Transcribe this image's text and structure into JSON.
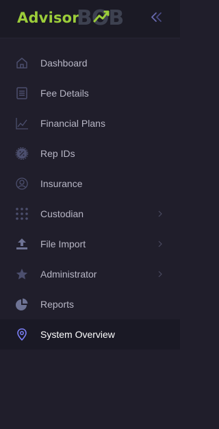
{
  "brand": {
    "text": "Advisor",
    "mark_text": "BOB",
    "accent_color": "#9ccd3a"
  },
  "nav": {
    "items": [
      {
        "label": "Dashboard",
        "icon": "home-icon"
      },
      {
        "label": "Fee Details",
        "icon": "receipt-icon"
      },
      {
        "label": "Financial Plans",
        "icon": "chart-line-icon"
      },
      {
        "label": "Rep IDs",
        "icon": "badge-percent-icon"
      },
      {
        "label": "Insurance",
        "icon": "user-circle-icon"
      },
      {
        "label": "Custodian",
        "icon": "grid-dots-icon",
        "has_submenu": true
      },
      {
        "label": "File Import",
        "icon": "upload-icon",
        "has_submenu": true
      },
      {
        "label": "Administrator",
        "icon": "star-icon",
        "has_submenu": true
      },
      {
        "label": "Reports",
        "icon": "pie-chart-icon"
      },
      {
        "label": "System Overview",
        "icon": "map-pin-icon",
        "active": true
      }
    ]
  },
  "colors": {
    "background": "#201e2b",
    "active": "#7b7ff7",
    "text": "#b8b7c6"
  }
}
